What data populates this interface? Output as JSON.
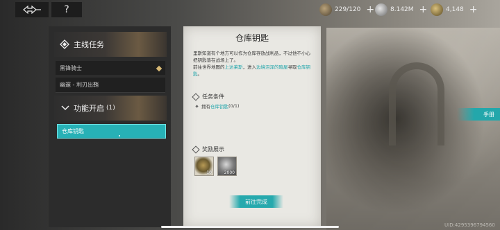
{
  "topbar": {
    "help_label": "?",
    "resources": [
      {
        "icon": "stamina-icon",
        "value": "229/120"
      },
      {
        "icon": "silver-coin-icon",
        "value": "8.142M"
      },
      {
        "icon": "gold-coin-icon",
        "value": "4,148"
      }
    ],
    "plus": "+"
  },
  "sidebar": {
    "main_quest_header": "主线任务",
    "quests": [
      {
        "label": "黑锋骑士"
      },
      {
        "label": "幽邃 - 利刃出鞘"
      }
    ],
    "feature_header": "功能开启",
    "feature_count": "(1)",
    "selected_item": "仓库钥匙"
  },
  "detail": {
    "title": "仓库钥匙",
    "desc_line1": "里斯知道有个地方可以作为仓库存放战利品，不过他不小心把钥匙落在战场上了。",
    "desc_pre": "前往世界地图的",
    "desc_loc1": "上达莱斯",
    "desc_mid": "，进入",
    "desc_loc2": "边境沼泽的暗屋",
    "desc_mid2": "寻取",
    "desc_target": "仓库钥匙",
    "desc_end": "。",
    "conditions_header": "任务条件",
    "condition_pre": "拥有",
    "condition_item": "仓库钥匙",
    "condition_progress": " (0/1)",
    "rewards_header": "奖励展示",
    "rewards": [
      {
        "icon": "ore-icon",
        "count": "10"
      },
      {
        "icon": "silver-coin-icon",
        "count": "2000"
      }
    ],
    "go_button": "前往完成"
  },
  "handbook_label": "手册",
  "uid": "UID:4295396794560",
  "colors": {
    "accent": "#26a9ad",
    "panel_dark": "#2c2c2c",
    "panel_light": "#e9e8e3",
    "gold": "#d7b874"
  }
}
